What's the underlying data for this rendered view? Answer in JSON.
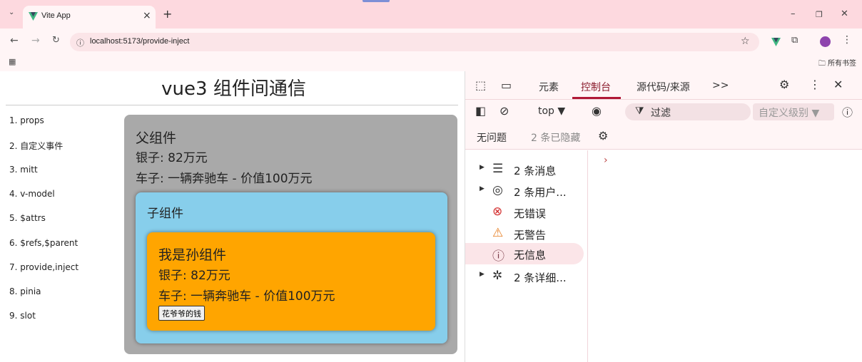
{
  "browser": {
    "tab_title": "Vite App",
    "tab_close": "×",
    "new_tab": "+",
    "url": "localhost:5173/provide-inject",
    "all_bookmarks": "所有书签"
  },
  "page": {
    "title": "vue3 组件间通信",
    "nav": [
      "1. props",
      "2. 自定义事件",
      "3. mitt",
      "4. v-model",
      "5. $attrs",
      "6. $refs,$parent",
      "7. provide,inject",
      "8. pinia",
      "9. slot"
    ],
    "father": {
      "title": "父组件",
      "money": "银子: 82万元",
      "car": "车子: 一辆奔驰车 - 价值100万元"
    },
    "child": {
      "title": "子组件"
    },
    "grandson": {
      "title": "我是孙组件",
      "money": "银子: 82万元",
      "car": "车子: 一辆奔驰车 - 价值100万元",
      "button": "花爷爷的钱"
    },
    "colors": {
      "father_bg": "#a9a9a9",
      "child_bg": "#87ceeb",
      "grandson_bg": "#ffa500"
    }
  },
  "devtools": {
    "tabs": [
      "元素",
      "控制台",
      "源代码/来源"
    ],
    "active_tab": "控制台",
    "more": ">>",
    "context": "top ▼",
    "filter_placeholder": "过滤",
    "level": "自定义级别 ▼",
    "issues": "无问题",
    "hidden": "2 条已隐藏",
    "sidebar": [
      {
        "icon": "list-icon",
        "label": "2 条消息",
        "expandable": true
      },
      {
        "icon": "user-icon",
        "label": "2 条用户...",
        "expandable": true
      },
      {
        "icon": "error-icon",
        "label": "无错误",
        "expandable": false
      },
      {
        "icon": "warning-icon",
        "label": "无警告",
        "expandable": false
      },
      {
        "icon": "info-icon",
        "label": "无信息",
        "expandable": false
      },
      {
        "icon": "bug-icon",
        "label": "2 条详细...",
        "expandable": true
      }
    ],
    "prompt": "›"
  }
}
